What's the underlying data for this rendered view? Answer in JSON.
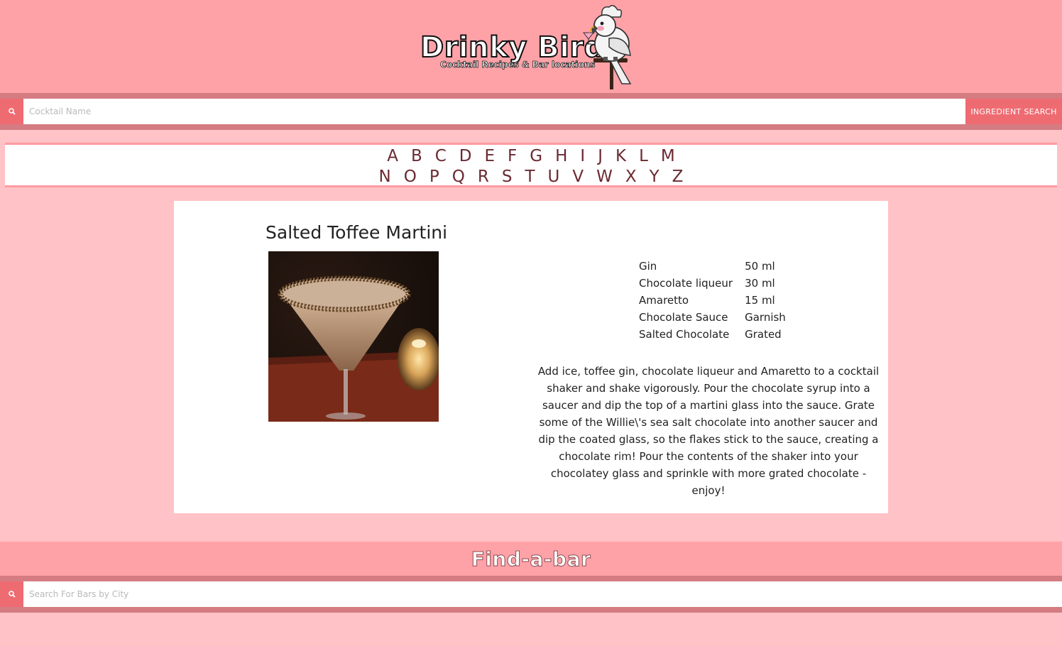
{
  "brand": {
    "title": "Drinky Bird",
    "subtitle": "Cocktail Recipes & Bar locations"
  },
  "cocktail_search": {
    "placeholder": "Cocktail Name",
    "ingredient_button": "INGREDIENT SEARCH"
  },
  "alphabet": {
    "row1": [
      "A",
      "B",
      "C",
      "D",
      "E",
      "F",
      "G",
      "H",
      "I",
      "J",
      "K",
      "L",
      "M"
    ],
    "row2": [
      "N",
      "O",
      "P",
      "Q",
      "R",
      "S",
      "T",
      "U",
      "V",
      "W",
      "X",
      "Y",
      "Z"
    ]
  },
  "drink": {
    "name": "Salted Toffee Martini",
    "ingredients": [
      {
        "name": "Gin",
        "amount": "50 ml"
      },
      {
        "name": "Chocolate liqueur",
        "amount": "30 ml"
      },
      {
        "name": "Amaretto",
        "amount": "15 ml"
      },
      {
        "name": "Chocolate Sauce",
        "amount": "Garnish"
      },
      {
        "name": "Salted Chocolate",
        "amount": "Grated"
      }
    ],
    "instructions": "Add ice, toffee gin, chocolate liqueur and Amaretto to a cocktail shaker and shake vigorously. Pour the chocolate syrup into a saucer and dip the top of a martini glass into the sauce. Grate some of the Willie\\'s sea salt chocolate into another saucer and dip the coated glass, so the flakes stick to the sauce, creating a chocolate rim! Pour the contents of the shaker into your chocolatey glass and sprinkle with more grated chocolate - enjoy!"
  },
  "find_a_bar": {
    "title": "Find-a-bar",
    "placeholder": "Search For Bars by City"
  },
  "icons": {
    "search": "search-icon",
    "logo": "cockatoo-logo-icon",
    "drink_photo": "martini-photo"
  }
}
